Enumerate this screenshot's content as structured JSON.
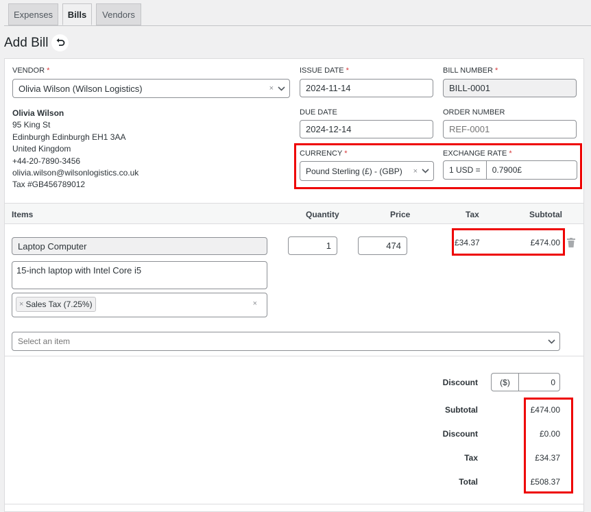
{
  "tabs": [
    {
      "label": "Expenses"
    },
    {
      "label": "Bills"
    },
    {
      "label": "Vendors"
    }
  ],
  "page_title": "Add Bill",
  "vendor": {
    "label": "VENDOR",
    "value": "Olivia Wilson (Wilson Logistics)",
    "name": "Olivia Wilson",
    "address1": "95 King St",
    "address2": "Edinburgh Edinburgh EH1 3AA",
    "country": "United Kingdom",
    "phone": "+44-20-7890-3456",
    "email": "olivia.wilson@wilsonlogistics.co.uk",
    "tax": "Tax #GB456789012"
  },
  "issue_date": {
    "label": "ISSUE DATE",
    "value": "2024-11-14"
  },
  "bill_number": {
    "label": "BILL NUMBER",
    "value": "BILL-0001"
  },
  "due_date": {
    "label": "DUE DATE",
    "value": "2024-12-14"
  },
  "order_number": {
    "label": "ORDER NUMBER",
    "placeholder": "REF-0001"
  },
  "currency": {
    "label": "CURRENCY",
    "value": "Pound Sterling (£) - (GBP)"
  },
  "exchange_rate": {
    "label": "EXCHANGE RATE",
    "prefix": "1 USD =",
    "value": "0.7900£"
  },
  "items_header": {
    "items": "Items",
    "quantity": "Quantity",
    "price": "Price",
    "tax": "Tax",
    "subtotal": "Subtotal"
  },
  "items": [
    {
      "name": "Laptop Computer",
      "description": "15-inch laptop with Intel Core i5",
      "tax_tag": "Sales Tax (7.25%)",
      "quantity": "1",
      "price": "474",
      "tax": "£34.37",
      "subtotal": "£474.00"
    }
  ],
  "select_item_placeholder": "Select an item",
  "discount_input": {
    "label": "Discount",
    "unit": "($)",
    "value": "0"
  },
  "totals": {
    "subtotal_label": "Subtotal",
    "subtotal": "£474.00",
    "discount_label": "Discount",
    "discount": "£0.00",
    "tax_label": "Tax",
    "tax": "£34.37",
    "total_label": "Total",
    "total": "£508.37"
  },
  "colors": {
    "highlight": "#ee0000",
    "required": "#d63638"
  }
}
